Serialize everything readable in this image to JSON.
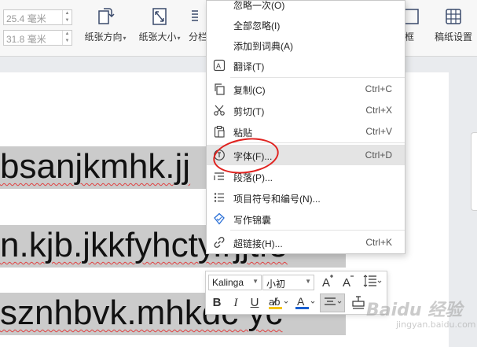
{
  "ribbon": {
    "width_value": "25.4 毫米",
    "height_value": "31.8 毫米",
    "buttons": [
      {
        "label": "纸张方向",
        "icon": "page-orientation-icon",
        "dropdown": true
      },
      {
        "label": "纸张大小",
        "icon": "page-size-icon",
        "dropdown": true
      },
      {
        "label": "分栏",
        "icon": "columns-icon",
        "dropdown": false
      },
      {
        "label": "边框",
        "icon": "page-border-icon",
        "dropdown": false
      },
      {
        "label": "稿纸设置",
        "icon": "manuscript-paper-icon",
        "dropdown": false
      }
    ]
  },
  "document": {
    "lines": [
      "bsanjkmhk.jj",
      "n.kjb.jkkfyhcty.rjjtfe",
      "sznhbvk.mhkdc yc"
    ]
  },
  "context_menu": {
    "items": [
      {
        "label": "忽略一次(O)",
        "shortcut": "",
        "icon": ""
      },
      {
        "label": "全部忽略(I)",
        "shortcut": "",
        "icon": ""
      },
      {
        "label": "添加到词典(A)",
        "shortcut": "",
        "icon": ""
      },
      {
        "label": "翻译(T)",
        "shortcut": "",
        "icon": "translate-icon"
      },
      {
        "label": "复制(C)",
        "shortcut": "Ctrl+C",
        "icon": "copy-icon"
      },
      {
        "label": "剪切(T)",
        "shortcut": "Ctrl+X",
        "icon": "cut-icon"
      },
      {
        "label": "粘贴",
        "shortcut": "Ctrl+V",
        "icon": "paste-icon"
      },
      {
        "label": "字体(F)...",
        "shortcut": "Ctrl+D",
        "icon": "font-icon"
      },
      {
        "label": "段落(P)...",
        "shortcut": "",
        "icon": "paragraph-icon"
      },
      {
        "label": "项目符号和编号(N)...",
        "shortcut": "",
        "icon": "bullets-numbering-icon"
      },
      {
        "label": "写作锦囊",
        "shortcut": "",
        "icon": "writing-tips-icon"
      },
      {
        "label": "超链接(H)...",
        "shortcut": "Ctrl+K",
        "icon": "hyperlink-icon"
      }
    ],
    "highlighted": "字体(F)..."
  },
  "mini_toolbar": {
    "font_name": "Kalinga",
    "font_size": "小初",
    "buttons": [
      "grow-font-icon",
      "shrink-font-icon",
      "line-spacing-icon",
      "bold-icon",
      "italic-icon",
      "underline-icon",
      "highlight-icon",
      "font-color-icon",
      "align-center-icon",
      "format-painter-icon"
    ],
    "bold": "B",
    "italic": "I",
    "underline": "U",
    "font_color_glyph": "A",
    "accent_blue": "#1a5fd0"
  },
  "watermark": {
    "brand": "Baidu 经验",
    "url": "jingyan.baidu.com"
  },
  "colors": {
    "selection_gray": "#cbcbcb",
    "menu_highlight": "#e4e4e4",
    "annotation_red": "#e0221f",
    "spell_underline": "#e04040"
  }
}
